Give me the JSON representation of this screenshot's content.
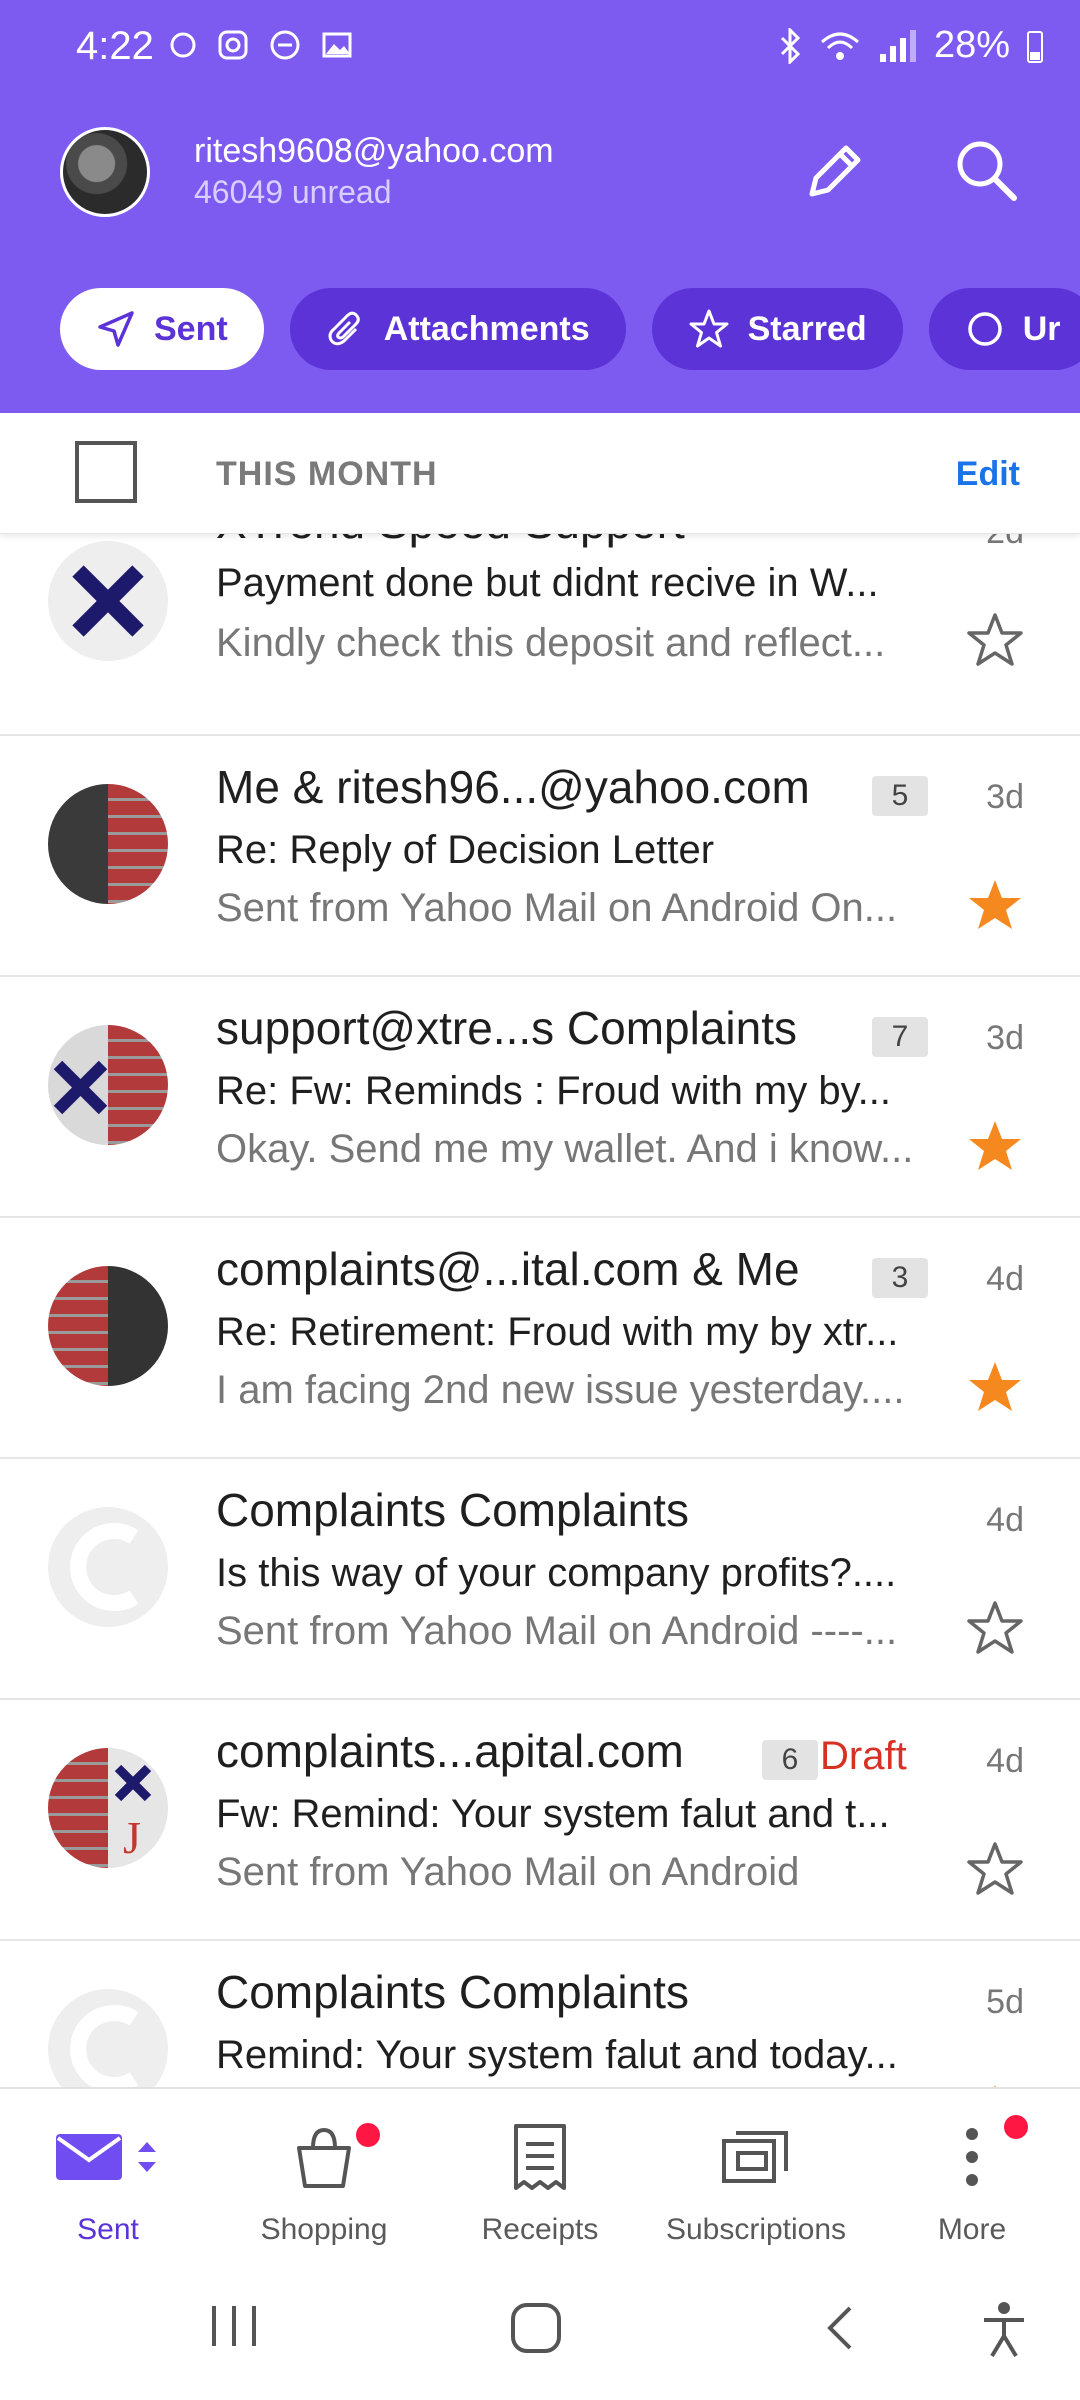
{
  "status": {
    "time": "4:22",
    "battery": "28%"
  },
  "account": {
    "email": "ritesh9608@yahoo.com",
    "unread": "46049 unread"
  },
  "chips": [
    "Sent",
    "Attachments",
    "Starred",
    "Ur"
  ],
  "section": {
    "title": "THIS MONTH",
    "edit": "Edit"
  },
  "messages": [
    {
      "sender": "XTrend Speed Support",
      "subject": "Payment done but didnt recive in W...",
      "snippet": "Kindly check this deposit and reflect...",
      "date": "2d",
      "starred": false
    },
    {
      "sender": "Me & ritesh96...@yahoo.com",
      "count": "5",
      "subject": "Re: Reply of  Decision Letter",
      "snippet": "Sent from Yahoo Mail on Android On...",
      "date": "3d",
      "starred": true
    },
    {
      "sender": "support@xtre...s Complaints",
      "count": "7",
      "subject": "Re: Fw: Reminds : Froud with my by...",
      "snippet": "Okay. Send me my wallet. And i know...",
      "date": "3d",
      "starred": true
    },
    {
      "sender": "complaints@...ital.com & Me",
      "count": "3",
      "subject": "Re: Retirement: Froud with my by xtr...",
      "snippet": "I am facing 2nd new issue yesterday....",
      "date": "4d",
      "starred": true
    },
    {
      "sender": "Complaints Complaints",
      "subject": "Is this way of your company profits?....",
      "snippet": "Sent from Yahoo Mail on Android ----...",
      "date": "4d",
      "starred": false
    },
    {
      "sender": "complaints...apital.com",
      "count": "6",
      "draft": "Draft",
      "subject": "Fw: Remind: Your system falut and t...",
      "snippet": "Sent from Yahoo Mail on Android",
      "date": "4d",
      "starred": false
    },
    {
      "sender": "Complaints Complaints",
      "subject": "Remind: Your system falut and today...",
      "date": "5d",
      "starred": true
    }
  ],
  "bottom_nav": [
    "Sent",
    "Shopping",
    "Receipts",
    "Subscriptions",
    "More"
  ],
  "colors": {
    "brand": "#7e5bf0",
    "chip": "#5b33d6",
    "star_filled": "#f5891f",
    "draft": "#d93025",
    "edit": "#1a73e8"
  }
}
